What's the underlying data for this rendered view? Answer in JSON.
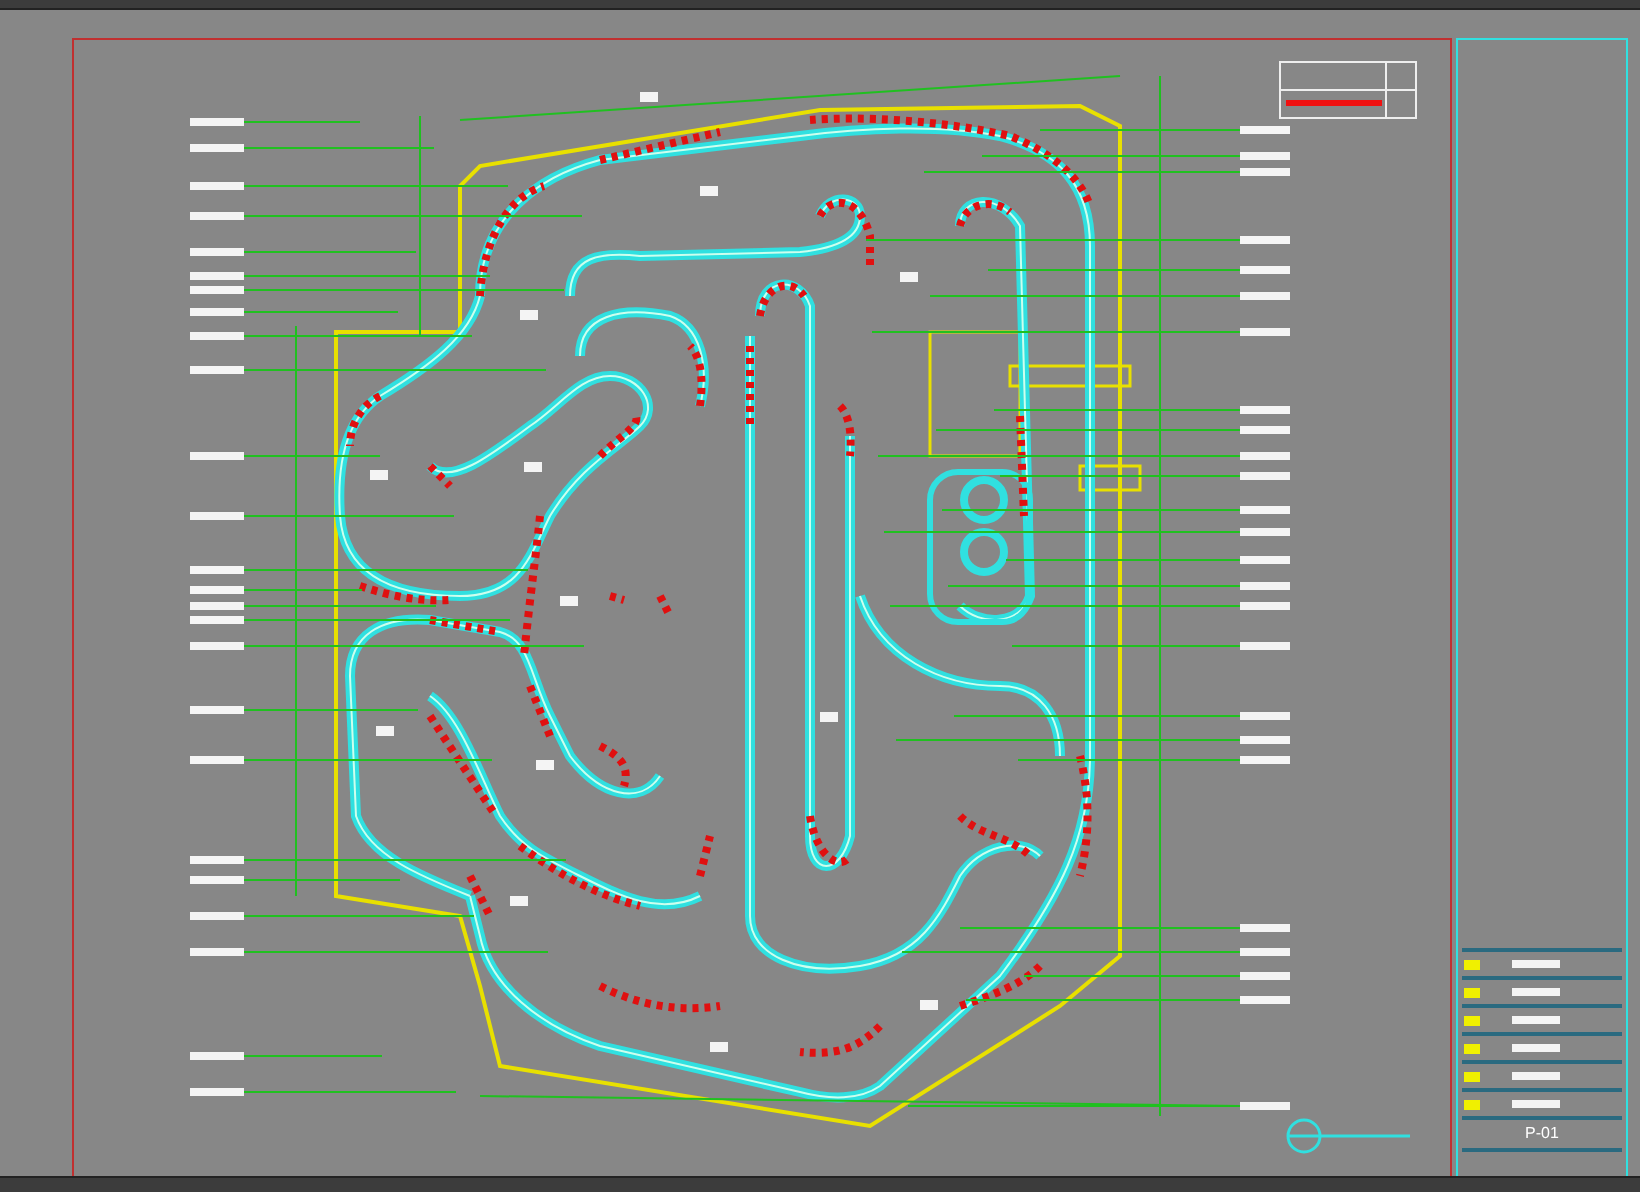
{
  "title_block": {
    "drawing_number": "P-01"
  }
}
